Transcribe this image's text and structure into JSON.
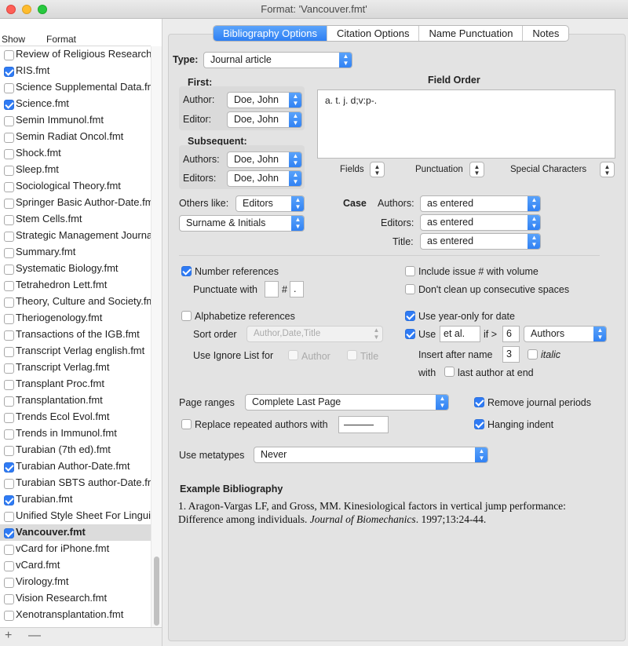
{
  "window": {
    "title": "Format: 'Vancouver.fmt'"
  },
  "sidebar": {
    "header_show": "Show",
    "header_format": "Format",
    "items": [
      {
        "name": "Review of Religious Research.fmt",
        "checked": false
      },
      {
        "name": "RIS.fmt",
        "checked": true
      },
      {
        "name": "Science Supplemental Data.fmt",
        "checked": false
      },
      {
        "name": "Science.fmt",
        "checked": true
      },
      {
        "name": "Semin Immunol.fmt",
        "checked": false
      },
      {
        "name": "Semin Radiat Oncol.fmt",
        "checked": false
      },
      {
        "name": "Shock.fmt",
        "checked": false
      },
      {
        "name": "Sleep.fmt",
        "checked": false
      },
      {
        "name": "Sociological Theory.fmt",
        "checked": false
      },
      {
        "name": "Springer Basic Author-Date.fmt",
        "checked": false
      },
      {
        "name": "Stem Cells.fmt",
        "checked": false
      },
      {
        "name": "Strategic Management Journal.fmt",
        "checked": false
      },
      {
        "name": "Summary.fmt",
        "checked": false
      },
      {
        "name": "Systematic Biology.fmt",
        "checked": false
      },
      {
        "name": "Tetrahedron Lett.fmt",
        "checked": false
      },
      {
        "name": "Theory, Culture and Society.fmt",
        "checked": false
      },
      {
        "name": "Theriogenology.fmt",
        "checked": false
      },
      {
        "name": "Transactions of the IGB.fmt",
        "checked": false
      },
      {
        "name": "Transcript Verlag english.fmt",
        "checked": false
      },
      {
        "name": "Transcript Verlag.fmt",
        "checked": false
      },
      {
        "name": "Transplant Proc.fmt",
        "checked": false
      },
      {
        "name": "Transplantation.fmt",
        "checked": false
      },
      {
        "name": "Trends Ecol Evol.fmt",
        "checked": false
      },
      {
        "name": "Trends in Immunol.fmt",
        "checked": false
      },
      {
        "name": "Turabian (7th ed).fmt",
        "checked": false
      },
      {
        "name": "Turabian Author-Date.fmt",
        "checked": true
      },
      {
        "name": "Turabian SBTS author-Date.fmt",
        "checked": false
      },
      {
        "name": "Turabian.fmt",
        "checked": true
      },
      {
        "name": "Unified Style Sheet For Linguistics.fmt",
        "checked": false
      },
      {
        "name": "Vancouver.fmt",
        "checked": true,
        "selected": true
      },
      {
        "name": "vCard for iPhone.fmt",
        "checked": false
      },
      {
        "name": "vCard.fmt",
        "checked": false
      },
      {
        "name": "Virology.fmt",
        "checked": false
      },
      {
        "name": "Vision Research.fmt",
        "checked": false
      },
      {
        "name": "Xenotransplantation.fmt",
        "checked": false
      }
    ],
    "add_label": "+",
    "remove_label": "—"
  },
  "tabs": [
    "Bibliography Options",
    "Citation Options",
    "Name Punctuation",
    "Notes"
  ],
  "active_tab": 0,
  "form": {
    "type_label": "Type:",
    "type_value": "Journal article",
    "first_label": "First:",
    "first_author_label": "Author:",
    "first_author_value": "Doe, John",
    "first_editor_label": "Editor:",
    "first_editor_value": "Doe, John",
    "subsequent_label": "Subsequent:",
    "sub_authors_label": "Authors:",
    "sub_authors_value": "Doe, John",
    "sub_editors_label": "Editors:",
    "sub_editors_value": "Doe, John",
    "field_order_label": "Field Order",
    "field_order_text": "a. t. j. d;v:p-.",
    "fields_label": "Fields",
    "punctuation_label": "Punctuation",
    "special_chars_label": "Special Characters",
    "others_like_label": "Others like:",
    "others_like_value": "Editors",
    "name_format_value": "Surname & Initials",
    "case_label": "Case",
    "case_authors_label": "Authors:",
    "case_authors_value": "as entered",
    "case_editors_label": "Editors:",
    "case_editors_value": "as entered",
    "case_title_label": "Title:",
    "case_title_value": "as entered",
    "number_refs_label": "Number references",
    "number_refs_checked": true,
    "punctuate_with_label": "Punctuate with",
    "punct_before": "",
    "punct_hash": "#",
    "punct_after": ".",
    "include_issue_label": "Include issue # with volume",
    "dont_clean_label": "Don't clean up consecutive spaces",
    "alphabetize_label": "Alphabetize references",
    "sort_order_label": "Sort order",
    "sort_order_value": "Author,Date,Title",
    "ignore_list_label": "Use Ignore List for",
    "ignore_author_label": "Author",
    "ignore_title_label": "Title",
    "year_only_label": "Use year-only for date",
    "use_label": "Use",
    "et_al_value": "et al.",
    "if_gt_label": "if >",
    "if_gt_value": "6",
    "authors_popup_value": "Authors",
    "insert_after_label": "Insert after name",
    "insert_after_value": "3",
    "italic_label": "italic",
    "with_label": "with",
    "last_author_label": "last author at end",
    "page_ranges_label": "Page ranges",
    "page_ranges_value": "Complete Last Page",
    "remove_periods_label": "Remove journal periods",
    "replace_repeated_label": "Replace repeated authors with",
    "hanging_indent_label": "Hanging indent",
    "metatypes_label": "Use metatypes",
    "metatypes_value": "Never",
    "example_heading": "Example Bibliography",
    "example_line1": "1. Aragon-Vargas LF, and Gross, MM. Kinesiological factors in vertical jump performance:",
    "example_line2_a": "Difference among individuals. ",
    "example_line2_journal": "Journal of Biomechanics",
    "example_line2_b": ". 1997;13:24-44."
  },
  "colors": {
    "accent": "#2f80f3",
    "selection": "#dcdcdc"
  },
  "icons": [
    "chevron-updown-icon",
    "checkmark-icon",
    "plus-icon",
    "minus-icon"
  ]
}
